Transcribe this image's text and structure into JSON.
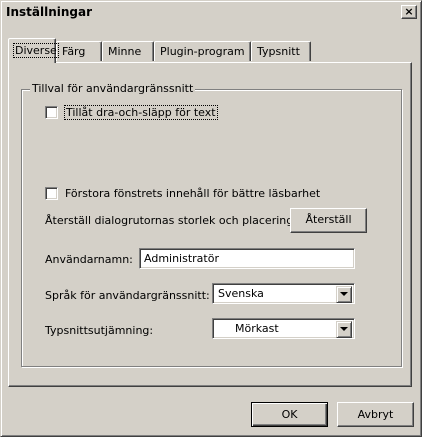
{
  "window": {
    "title": "Inställningar",
    "close_glyph": "×"
  },
  "tabs": [
    {
      "label": "Diverse",
      "active": true
    },
    {
      "label": "Färg",
      "active": false
    },
    {
      "label": "Minne",
      "active": false
    },
    {
      "label": "Plugin-program",
      "active": false
    },
    {
      "label": "Typsnitt",
      "active": false
    }
  ],
  "group": {
    "legend": "Tillval för användargränssnitt",
    "drag_drop": {
      "label": "Tillåt dra-och-släpp för text",
      "checked": false
    },
    "magnify": {
      "label": "Förstora fönstrets innehåll för bättre läsbarhet",
      "checked": false
    },
    "reset_label": "Återställ dialogrutornas storlek och placering:",
    "reset_button": "Återställ",
    "username_label": "Användarnamn:",
    "username_value": "Administratör",
    "language_label": "Språk för användargränssnitt:",
    "language_value": "Svenska",
    "smoothing_label": "Typsnittsutjämning:",
    "smoothing_value": "Mörkast"
  },
  "footer": {
    "ok_label": "OK",
    "cancel_label": "Avbryt"
  },
  "icons": {
    "close": "close-icon",
    "dropdown": "chevron-down-icon"
  }
}
